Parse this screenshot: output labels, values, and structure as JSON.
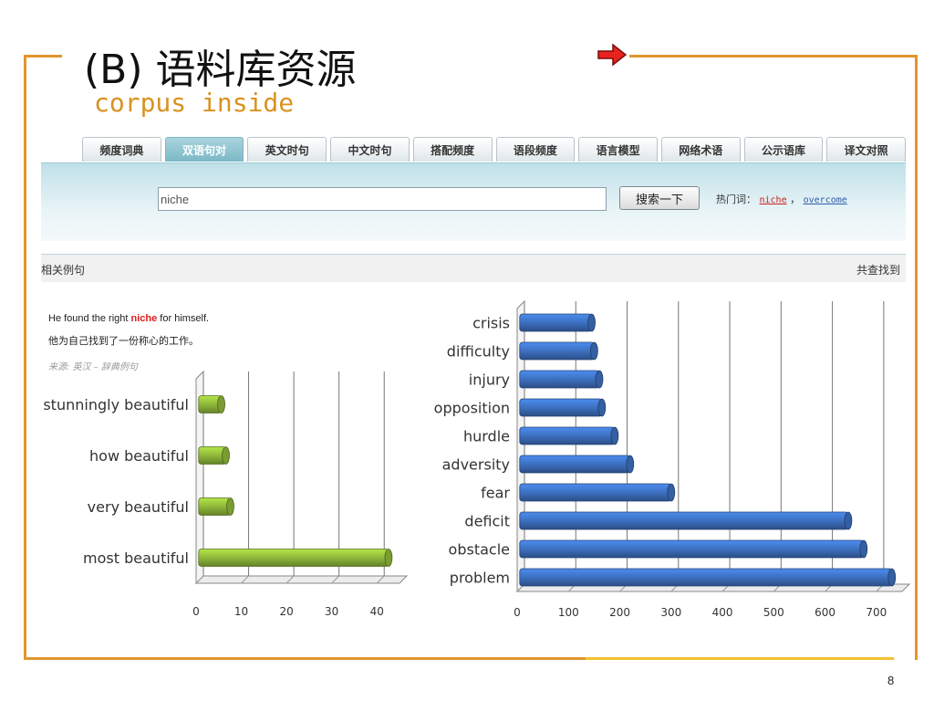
{
  "slide": {
    "title": "(B)  语料库资源",
    "subtitle": "corpus inside",
    "page_number": "8"
  },
  "web": {
    "tabs": [
      {
        "label": "频度词典",
        "active": false
      },
      {
        "label": "双语句对",
        "active": true
      },
      {
        "label": "英文时句",
        "active": false
      },
      {
        "label": "中文时句",
        "active": false
      },
      {
        "label": "搭配频度",
        "active": false
      },
      {
        "label": "语段频度",
        "active": false
      },
      {
        "label": "语言模型",
        "active": false
      },
      {
        "label": "网络术语",
        "active": false
      },
      {
        "label": "公示语库",
        "active": false
      },
      {
        "label": "译文对照",
        "active": false
      }
    ],
    "search": {
      "value": "niche",
      "button_label": "搜索一下"
    },
    "hot_words": {
      "label": "热门词：",
      "items": [
        "niche",
        "overcome"
      ],
      "separator": "，"
    },
    "results": {
      "left_label": "相关例句",
      "right_label": "共查找到"
    },
    "example": {
      "en_before": "He found the right ",
      "keyword": "niche",
      "en_after": " for himself.",
      "zh": "他为自己找到了一份称心的工作。",
      "source": "来源: 英汉 – 辞典例句"
    }
  },
  "chart_data": [
    {
      "type": "bar",
      "orientation": "horizontal",
      "color": "#8fb83a",
      "categories": [
        "stunningly beautiful",
        "how beautiful",
        "very beautiful",
        "most beautiful"
      ],
      "values": [
        5,
        6,
        7,
        42
      ],
      "xlim": [
        0,
        45
      ],
      "xticks": [
        0,
        10,
        20,
        30,
        40
      ],
      "grid": true
    },
    {
      "type": "bar",
      "orientation": "horizontal",
      "color": "#3d70c0",
      "categories": [
        "crisis",
        "difficulty",
        "injury",
        "opposition",
        "hurdle",
        "adversity",
        "fear",
        "deficit",
        "obstacle",
        "problem"
      ],
      "values": [
        140,
        145,
        155,
        160,
        185,
        215,
        295,
        640,
        670,
        725
      ],
      "xlim": [
        0,
        750
      ],
      "xticks": [
        0,
        100,
        200,
        300,
        400,
        500,
        600,
        700
      ],
      "grid": true
    }
  ]
}
